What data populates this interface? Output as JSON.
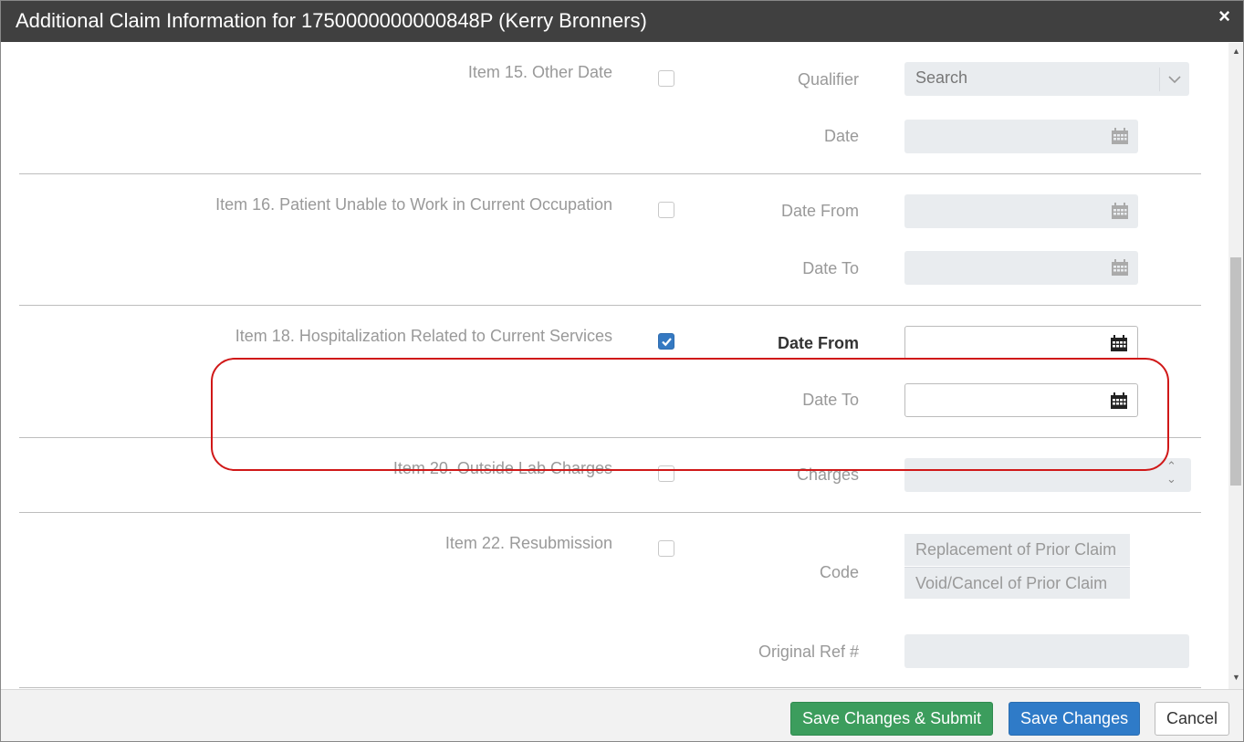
{
  "dialog": {
    "title": "Additional Claim Information for 1750000000000848P (Kerry Bronners)",
    "close_glyph": "×"
  },
  "items": [
    {
      "label": "Item 15. Other Date",
      "checked": false,
      "fields": [
        "Qualifier",
        "Date"
      ],
      "qualifier_placeholder": "Search"
    },
    {
      "label": "Item 16. Patient Unable to Work in Current Occupation",
      "checked": false,
      "fields": [
        "Date From",
        "Date To"
      ]
    },
    {
      "label": "Item 18. Hospitalization Related to Current Services",
      "checked": true,
      "fields": [
        "Date From",
        "Date To"
      ]
    },
    {
      "label": "Item 20. Outside Lab Charges",
      "checked": false,
      "fields": [
        "Charges"
      ]
    },
    {
      "label": "Item 22. Resubmission",
      "checked": false,
      "fields": [
        "Code",
        "Original Ref #"
      ],
      "code_options": [
        "Replacement of Prior Claim",
        "Void/Cancel of Prior Claim"
      ]
    }
  ],
  "footer": {
    "save_submit_label": "Save Changes & Submit",
    "save_label": "Save Changes",
    "cancel_label": "Cancel"
  },
  "colors": {
    "titlebar": "#404040",
    "primary": "#2f7bc8",
    "success": "#3c9d5d",
    "highlight": "#d01818",
    "disabled_field": "#e9ecef"
  }
}
